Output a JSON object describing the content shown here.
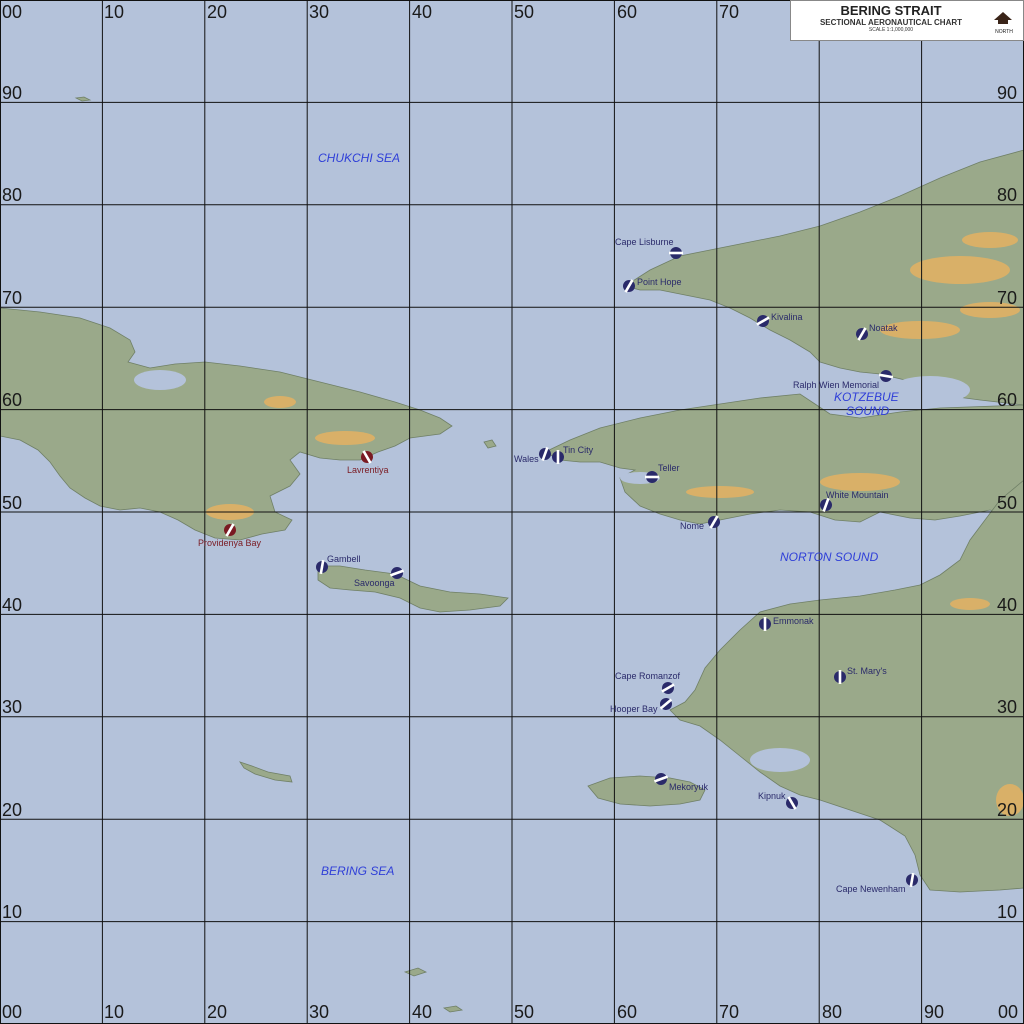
{
  "title": {
    "name": "BERING STRAIT",
    "subtitle": "SECTIONAL AERONAUTICAL CHART",
    "scale": "SCALE 1:1,000,000",
    "north": "NORTH"
  },
  "grid": {
    "top_labels": [
      "00",
      "10",
      "20",
      "30",
      "40",
      "50",
      "60",
      "70"
    ],
    "bottom_labels": [
      "00",
      "10",
      "20",
      "30",
      "40",
      "50",
      "60",
      "70",
      "80",
      "90",
      "00"
    ],
    "left_labels": [
      "90",
      "80",
      "70",
      "60",
      "50",
      "40",
      "30",
      "20",
      "10"
    ],
    "right_labels": [
      "90",
      "80",
      "70",
      "60",
      "50",
      "40",
      "30",
      "20",
      "10"
    ]
  },
  "seas": [
    "CHUKCHI SEA",
    "KOTZEBUE",
    "SOUND",
    "NORTON SOUND",
    "BERING SEA"
  ],
  "airports": [
    {
      "label": "Cape Lisburne",
      "country": "us"
    },
    {
      "label": "Point Hope",
      "country": "us"
    },
    {
      "label": "Kivalina",
      "country": "us"
    },
    {
      "label": "Noatak",
      "country": "us"
    },
    {
      "label": "Ralph Wien Memorial",
      "country": "us"
    },
    {
      "label": "Wales",
      "country": "us"
    },
    {
      "label": "Tin City",
      "country": "us"
    },
    {
      "label": "Teller",
      "country": "us"
    },
    {
      "label": "White Mountain",
      "country": "us"
    },
    {
      "label": "Nome",
      "country": "us"
    },
    {
      "label": "Lavrentiya",
      "country": "ru"
    },
    {
      "label": "Providenya Bay",
      "country": "ru"
    },
    {
      "label": "Gambell",
      "country": "us"
    },
    {
      "label": "Savoonga",
      "country": "us"
    },
    {
      "label": "Emmonak",
      "country": "us"
    },
    {
      "label": "St. Mary's",
      "country": "us"
    },
    {
      "label": "Cape Romanzof",
      "country": "us"
    },
    {
      "label": "Hooper Bay",
      "country": "us"
    },
    {
      "label": "Mekoryuk",
      "country": "us"
    },
    {
      "label": "Kipnuk",
      "country": "us"
    },
    {
      "label": "Cape Newenham",
      "country": "us"
    }
  ],
  "colors": {
    "water": "#b4c2da",
    "land": "#9aa98a",
    "mountain": "#d9b068",
    "airport_us": "#2a2a6a",
    "airport_ru": "#7a1a22",
    "sea_label": "#2f3fd8"
  }
}
